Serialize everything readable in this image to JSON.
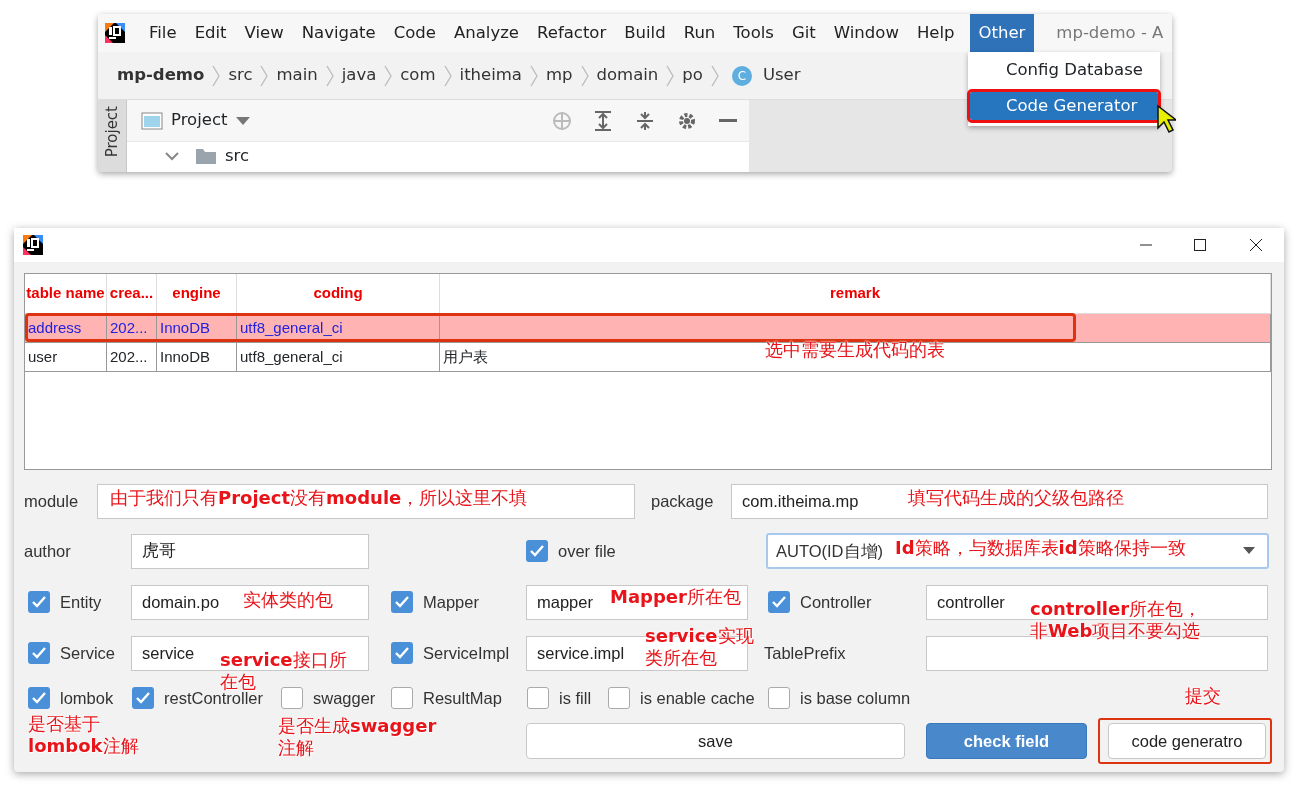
{
  "ide": {
    "menu": [
      {
        "label": "File",
        "selected": false
      },
      {
        "label": "Edit",
        "selected": false
      },
      {
        "label": "View",
        "selected": false
      },
      {
        "label": "Navigate",
        "selected": false
      },
      {
        "label": "Code",
        "selected": false
      },
      {
        "label": "Analyze",
        "selected": false
      },
      {
        "label": "Refactor",
        "selected": false
      },
      {
        "label": "Build",
        "selected": false
      },
      {
        "label": "Run",
        "selected": false
      },
      {
        "label": "Tools",
        "selected": false
      },
      {
        "label": "Git",
        "selected": false
      },
      {
        "label": "Window",
        "selected": false
      },
      {
        "label": "Help",
        "selected": false
      },
      {
        "label": "Other",
        "selected": true
      }
    ],
    "title": "mp-demo - A",
    "dropdown": [
      {
        "label": "Config Database",
        "selected": false
      },
      {
        "label": "Code Generator",
        "selected": true
      }
    ],
    "breadcrumb": [
      {
        "text": "mp-demo",
        "kind": "project"
      },
      {
        "text": "src",
        "kind": "folder"
      },
      {
        "text": "main",
        "kind": "folder"
      },
      {
        "text": "java",
        "kind": "folder"
      },
      {
        "text": "com",
        "kind": "folder"
      },
      {
        "text": "itheima",
        "kind": "folder"
      },
      {
        "text": "mp",
        "kind": "folder"
      },
      {
        "text": "domain",
        "kind": "folder"
      },
      {
        "text": "po",
        "kind": "folder"
      },
      {
        "text": "User",
        "kind": "class",
        "icon": "C"
      }
    ],
    "side_tab": "Project",
    "panel_title": "Project",
    "tree": [
      {
        "label": "src",
        "expanded": true
      }
    ]
  },
  "dialog": {
    "table": {
      "columns": [
        "table name",
        "crea...",
        "engine",
        "coding",
        "remark"
      ],
      "rows": [
        {
          "cells": [
            "address",
            "202...",
            "InnoDB",
            "utf8_general_ci",
            ""
          ],
          "selected": true
        },
        {
          "cells": [
            "user",
            "202...",
            "InnoDB",
            "utf8_general_ci",
            "用户表"
          ],
          "selected": false
        }
      ],
      "note": "选中需要生成代码的表"
    },
    "form": [
      [
        {
          "kind": "label",
          "text": "module"
        },
        {
          "kind": "input",
          "note": "由于我们只有**Project**没有**module**，所以这里不填"
        },
        {
          "kind": "label",
          "text": "package"
        },
        {
          "kind": "input",
          "value": "com.itheima.mp",
          "note": "填写代码生成的父级包路径"
        }
      ],
      [
        {
          "kind": "label",
          "text": "author"
        },
        {
          "kind": "input",
          "value": "虎哥"
        },
        {
          "kind": "checkbox",
          "text": "over file",
          "checked": true
        },
        {
          "kind": "select",
          "value": "AUTO(ID自增)",
          "note": "**Id**策略，与数据库表**id**策略保持一致"
        }
      ],
      [
        {
          "kind": "checkbox",
          "text": "Entity",
          "checked": true
        },
        {
          "kind": "input",
          "value": "domain.po",
          "note": "实体类的包"
        },
        {
          "kind": "checkbox",
          "text": "Mapper",
          "checked": true
        },
        {
          "kind": "input",
          "value": "mapper",
          "note": "**Mapper**所在包"
        },
        {
          "kind": "checkbox",
          "text": "Controller",
          "checked": true
        },
        {
          "kind": "input",
          "value": "controller",
          "note": [
            "**controller**所在包，",
            "非**Web**项目不要勾选"
          ]
        }
      ],
      [
        {
          "kind": "checkbox",
          "text": "Service",
          "checked": true
        },
        {
          "kind": "input",
          "value": "service",
          "note": [
            "**service**接口所",
            "在包"
          ]
        },
        {
          "kind": "checkbox",
          "text": "ServiceImpl",
          "checked": true
        },
        {
          "kind": "input",
          "value": "service.impl",
          "note": [
            "**service**实现",
            "类所在包"
          ]
        },
        {
          "kind": "label",
          "text": "TablePrefix"
        },
        {
          "kind": "input"
        }
      ],
      [
        {
          "kind": "checkbox",
          "text": "lombok",
          "checked": true,
          "note": [
            "是否基于",
            "**lombok**注解"
          ]
        },
        {
          "kind": "checkbox",
          "text": "restController",
          "checked": true
        },
        {
          "kind": "checkbox",
          "text": "swagger",
          "checked": false,
          "note": [
            "是否生成**swagger**",
            "注解"
          ]
        },
        {
          "kind": "checkbox",
          "text": "ResultMap",
          "checked": false
        },
        {
          "kind": "checkbox",
          "text": "is fill",
          "checked": false
        },
        {
          "kind": "checkbox",
          "text": "is enable cache",
          "checked": false
        },
        {
          "kind": "checkbox",
          "text": "is base column",
          "checked": false
        }
      ],
      [
        {
          "kind": "button",
          "text": "save",
          "primary": false
        },
        {
          "kind": "button",
          "text": "check field",
          "primary": true
        },
        {
          "kind": "button",
          "text": "code generatro",
          "primary": false,
          "highlighted": true,
          "note": "提交"
        }
      ]
    ]
  }
}
